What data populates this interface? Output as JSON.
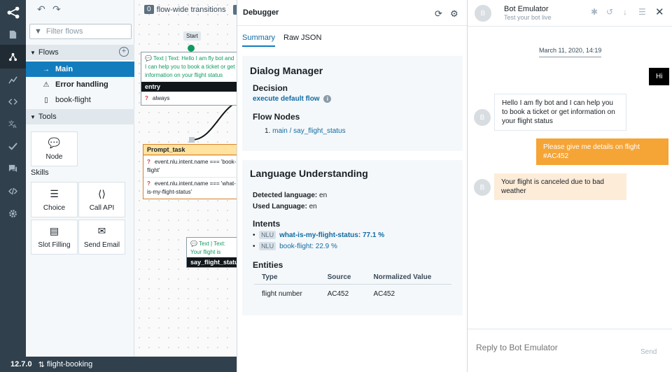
{
  "footer": {
    "version": "12.7.0",
    "bot_name": "flight-booking"
  },
  "rail": {
    "items": [
      "network-icon",
      "document-icon",
      "flows-icon",
      "analytics-icon",
      "code-icon",
      "translate-icon",
      "check-icon",
      "chat-icon",
      "code-block-icon",
      "settings-icon"
    ]
  },
  "flows_panel": {
    "filter_placeholder": "Filter flows",
    "flows_header": "Flows",
    "flows": [
      {
        "label": "Main"
      },
      {
        "label": "Error handling"
      },
      {
        "label": "book-flight"
      }
    ],
    "tools_header": "Tools",
    "node_label": "Node",
    "skills_label": "Skills",
    "skills": [
      "Choice",
      "Call API",
      "Slot Filling",
      "Send Email"
    ]
  },
  "canvas": {
    "transitions_count": "0",
    "transitions_label": "flow-wide transitions",
    "start_label": "Start",
    "entry_node": {
      "say": "Text | Text: Hello I am fly bot and I can help you to book a ticket or get information on your flight status",
      "title": "entry",
      "condition": "always"
    },
    "prompt_node": {
      "title": "Prompt_task",
      "cond1": "event.nlu.intent.name === 'book-flight'",
      "cond2": "event.nlu.intent.name === 'what-is-my-flight-status'"
    },
    "status_node": {
      "say": "Text | Text: Your flight is canceled due to bad weather",
      "title": "say_flight_status"
    }
  },
  "debugger": {
    "title": "Debugger",
    "tabs": [
      "Summary",
      "Raw JSON"
    ],
    "dialog_manager": {
      "heading": "Dialog Manager",
      "decision_label": "Decision",
      "decision_value": "execute default flow",
      "flow_nodes_label": "Flow Nodes",
      "flow_nodes": [
        "main / say_flight_status"
      ]
    },
    "nlu": {
      "heading": "Language Understanding",
      "detected_label": "Detected language:",
      "detected_value": "en",
      "used_label": "Used Language:",
      "used_value": "en",
      "intents_label": "Intents",
      "nlu_tag": "NLU",
      "intents": [
        {
          "name": "what-is-my-flight-status: 77.1 %",
          "bold": true
        },
        {
          "name": "book-flight: 22.9 %",
          "bold": false
        }
      ],
      "entities_label": "Entities",
      "entity_columns": [
        "Type",
        "Source",
        "Normalized Value"
      ],
      "entity_rows": [
        [
          "flight number",
          "AC452",
          "AC452"
        ]
      ]
    }
  },
  "emulator": {
    "title": "Bot Emulator",
    "subtitle": "Test your bot live",
    "avatar_letter": "B",
    "date": "March 11, 2020, 14:19",
    "messages": [
      "Hi",
      "Hello I am fly bot and I can help you to book a ticket or get information on your flight status",
      "Please give me details on flight #AC452",
      "Your flight is canceled due to bad weather"
    ],
    "composer_placeholder": "Reply to Bot Emulator",
    "send_label": "Send"
  },
  "colors": {
    "rail_bg": "#30404d",
    "active_blue": "#137cbd",
    "user_bubble": "#f5a436",
    "start_green": "#0f9960",
    "prompt_yellow": "#ffe39f"
  }
}
